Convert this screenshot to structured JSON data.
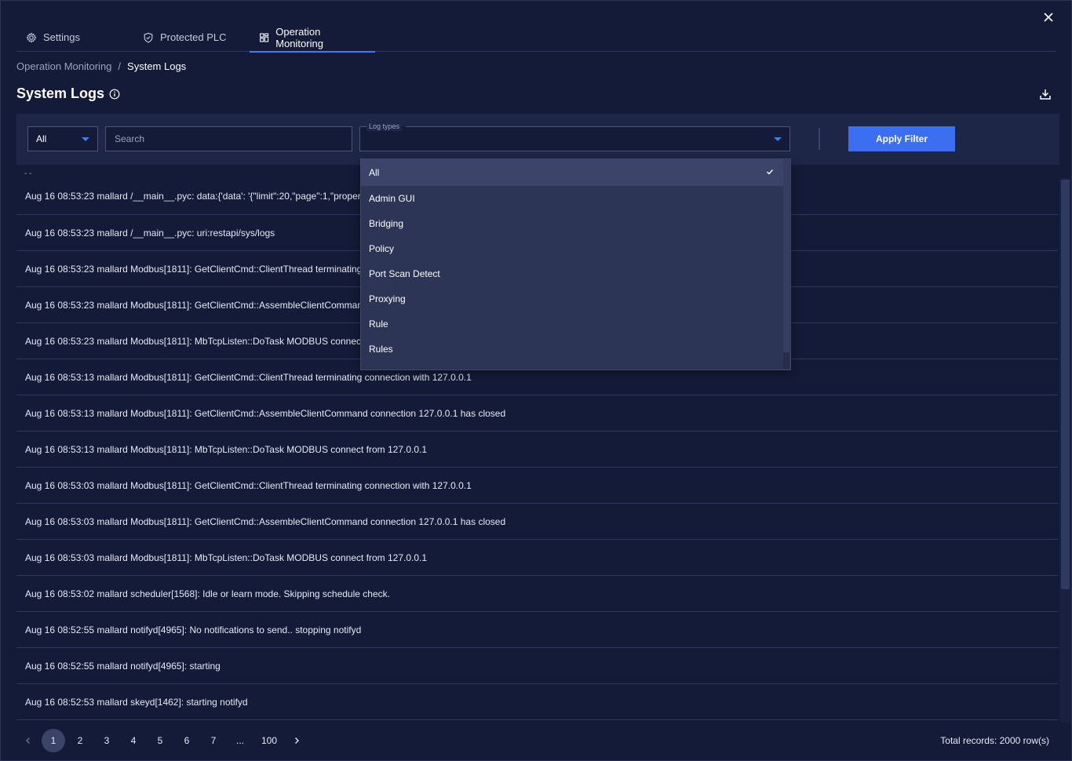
{
  "tabs": [
    {
      "label": "Settings",
      "icon": "gear-icon"
    },
    {
      "label": "Protected PLC",
      "icon": "shield-icon"
    },
    {
      "label": "Operation Monitoring",
      "icon": "dashboard-icon"
    }
  ],
  "active_tab": "Operation Monitoring",
  "breadcrumb": {
    "parent": "Operation Monitoring",
    "separator": "/",
    "current": "System Logs"
  },
  "page_title": "System Logs",
  "filter": {
    "level_select": "All",
    "search_placeholder": "Search",
    "log_types_label": "Log types",
    "log_types_value": "",
    "apply_label": "Apply Filter"
  },
  "log_types_dropdown": {
    "selected": "All",
    "options": [
      "All",
      "Admin GUI",
      "Bridging",
      "Policy",
      "Port Scan Detect",
      "Proxying",
      "Rule",
      "Rules"
    ]
  },
  "log_dots": "- -",
  "logs": [
    "Aug 16 08:53:23 mallard /__main__.pyc: data:{'data': '{\"limit\":20,\"page\":1,\"propertie",
    "Aug 16 08:53:23 mallard /__main__.pyc: uri:restapi/sys/logs",
    "Aug 16 08:53:23 mallard Modbus[1811]: GetClientCmd::ClientThread terminating c",
    "Aug 16 08:53:23 mallard Modbus[1811]: GetClientCmd::AssembleClientCommand",
    "Aug 16 08:53:23 mallard Modbus[1811]: MbTcpListen::DoTask MODBUS connect f",
    "Aug 16 08:53:13 mallard Modbus[1811]: GetClientCmd::ClientThread terminating connection with 127.0.0.1",
    "Aug 16 08:53:13 mallard Modbus[1811]: GetClientCmd::AssembleClientCommand connection 127.0.0.1 has closed",
    "Aug 16 08:53:13 mallard Modbus[1811]: MbTcpListen::DoTask MODBUS connect from 127.0.0.1",
    "Aug 16 08:53:03 mallard Modbus[1811]: GetClientCmd::ClientThread terminating connection with 127.0.0.1",
    "Aug 16 08:53:03 mallard Modbus[1811]: GetClientCmd::AssembleClientCommand connection 127.0.0.1 has closed",
    "Aug 16 08:53:03 mallard Modbus[1811]: MbTcpListen::DoTask MODBUS connect from 127.0.0.1",
    "Aug 16 08:53:02 mallard scheduler[1568]: Idle or learn mode. Skipping schedule check.",
    "Aug 16 08:52:55 mallard notifyd[4965]: No notifications to send.. stopping notifyd",
    "Aug 16 08:52:55 mallard notifyd[4965]: starting",
    "Aug 16 08:52:53 mallard skeyd[1462]: starting notifyd"
  ],
  "pagination": {
    "pages": [
      "1",
      "2",
      "3",
      "4",
      "5",
      "6",
      "7"
    ],
    "ellipsis": "...",
    "last": "100",
    "current": "1"
  },
  "total_records": "Total records: 2000 row(s)",
  "colors": {
    "background": "#141b38",
    "panel": "#1d2647",
    "accent": "#3b6ef0",
    "dropdown": "#2c3555"
  }
}
